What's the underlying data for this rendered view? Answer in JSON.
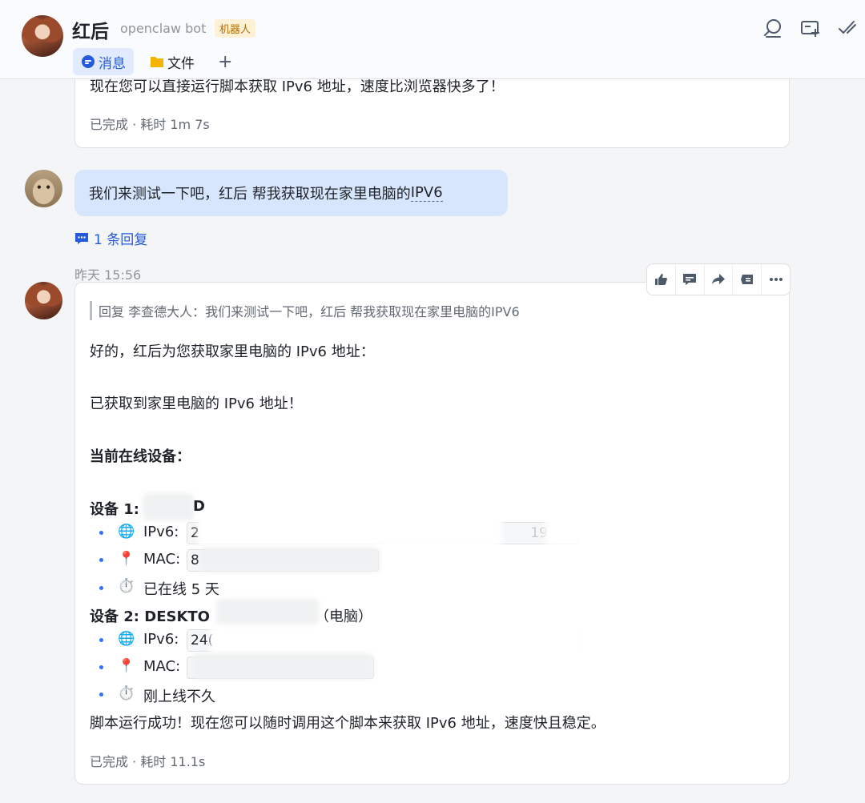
{
  "header": {
    "title": "红后",
    "subtitle": "openclaw bot",
    "tag": "机器人",
    "tabs": [
      {
        "label": "消息",
        "active": true
      },
      {
        "label": "文件",
        "active": false
      }
    ],
    "add_tab": "+",
    "icons": [
      "search-icon",
      "add-window-icon",
      "check-icon"
    ]
  },
  "prev_message": {
    "text": "现在您可以直接运行脚本获取 IPv6 地址，速度比浏览器快多了！",
    "status": "已完成 · 耗时 1m 7s"
  },
  "user_message": {
    "text_prefix": "我们来测试一下吧，红后 帮我获取现在家里电脑的",
    "text_link": "IPV6",
    "reply_count": "1 条回复"
  },
  "timestamp": "昨天 15:56",
  "bot_message": {
    "quote": "回复 李查德大人：我们来测试一下吧，红后 帮我获取现在家里电脑的IPV6",
    "intro": "好的，红后为您获取家里电脑的 IPv6 地址：",
    "result": "已获取到家里电脑的 IPv6 地址！",
    "section": "当前在线设备：",
    "device1": {
      "title_a": "设备 1:",
      "title_b": "D",
      "ipv6_label": "IPv6:",
      "ipv6_value": "2",
      "ipv6_tail": "19",
      "mac_label": "MAC:",
      "mac_value": "8",
      "status": "已在线 5 天"
    },
    "device2": {
      "title": "设备 2: DESKTO",
      "suffix": "（电脑）",
      "ipv6_label": "IPv6:",
      "ipv6_value": "24(",
      "mac_label": "MAC:",
      "mac_value": "",
      "status": "刚上线不久"
    },
    "conclusion": "脚本运行成功！现在您可以随时调用这个脚本来获取 IPv6 地址，速度快且稳定。",
    "status": "已完成 · 耗时 11.1s"
  },
  "toolbar": [
    "thumbs-up-icon",
    "comment-icon",
    "forward-icon",
    "pin-icon",
    "more-icon"
  ],
  "colors": {
    "accent": "#245bdb",
    "bubble": "#d8e6fd",
    "bullet": "#3370ff"
  }
}
